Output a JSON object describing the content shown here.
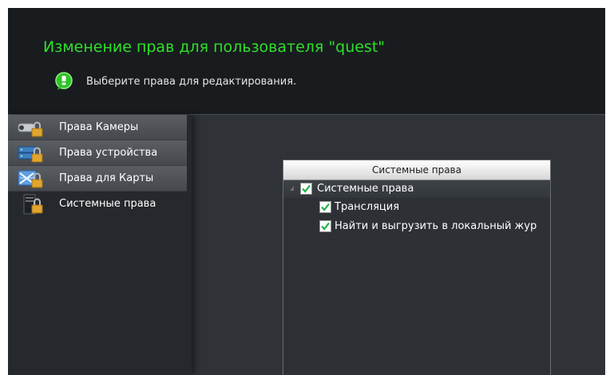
{
  "header": {
    "title": "Изменение прав для пользователя \"quest\"",
    "hint": "Выберите права для редактирования."
  },
  "sidebar": {
    "items": [
      {
        "label": "Права Камеры",
        "icon": "camera-lock-icon",
        "active": false
      },
      {
        "label": "Права устройства",
        "icon": "device-lock-icon",
        "active": false
      },
      {
        "label": "Права для Карты",
        "icon": "map-lock-icon",
        "active": false
      },
      {
        "label": "Системные права",
        "icon": "system-lock-icon",
        "active": true
      }
    ]
  },
  "panel": {
    "header": "Системные права",
    "tree": {
      "root": {
        "label": "Системные права",
        "checked": true,
        "expanded": true
      },
      "children": [
        {
          "label": "Трансляция",
          "checked": true
        },
        {
          "label": "Найти и выгрузить в локальный жур",
          "checked": true
        }
      ]
    }
  },
  "colors": {
    "title": "#2fe02a",
    "background": "#2f3337",
    "header_background": "#191c1f",
    "checkmark": "#22b14c"
  }
}
